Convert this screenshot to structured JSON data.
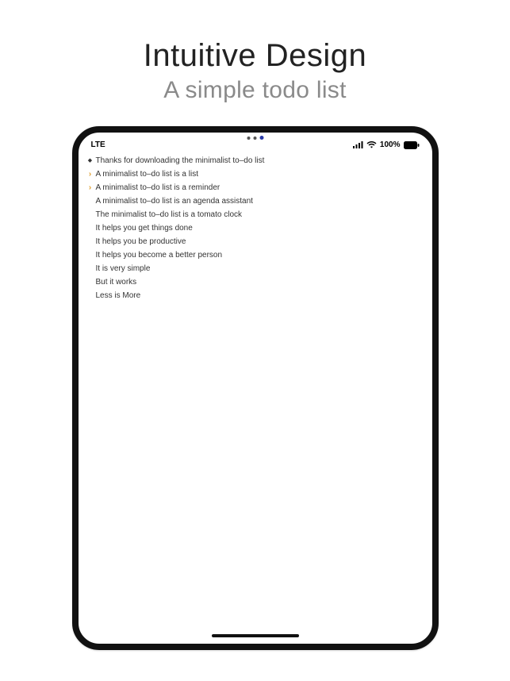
{
  "marketing": {
    "headline": "Intuitive Design",
    "subheadline": "A simple todo list"
  },
  "status": {
    "carrier": "LTE",
    "battery_percent": "100%"
  },
  "todo_items": [
    {
      "bullet": "diamond",
      "text": "Thanks for downloading the minimalist to–do list"
    },
    {
      "bullet": "chevron",
      "text": "A minimalist to–do list is a list"
    },
    {
      "bullet": "chevron",
      "text": "A minimalist to–do list is a reminder"
    },
    {
      "bullet": "none",
      "text": "A minimalist to–do list is an agenda assistant"
    },
    {
      "bullet": "none",
      "text": "The minimalist to–do list is a tomato clock"
    },
    {
      "bullet": "none",
      "text": "It helps you get things done"
    },
    {
      "bullet": "none",
      "text": "It helps you be productive"
    },
    {
      "bullet": "none",
      "text": "It helps you become a better person"
    },
    {
      "bullet": "none",
      "text": "It is very simple"
    },
    {
      "bullet": "none",
      "text": "But it works"
    },
    {
      "bullet": "none",
      "text": "Less is More"
    }
  ]
}
